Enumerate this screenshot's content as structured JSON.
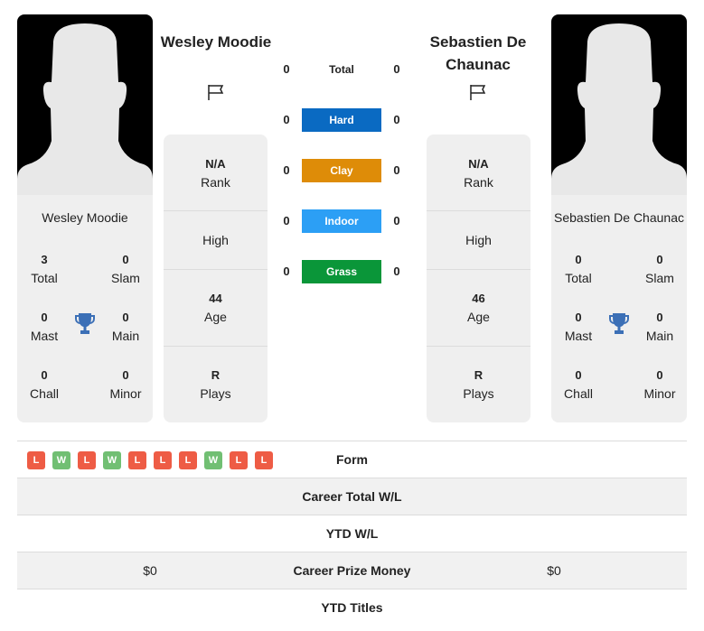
{
  "players": [
    {
      "name_heading": "Wesley Moodie",
      "card_name": "Wesley Moodie",
      "flag_icon": "flag-icon",
      "titles": {
        "total": {
          "value": "3",
          "label": "Total"
        },
        "slam": {
          "value": "0",
          "label": "Slam"
        },
        "mast": {
          "value": "0",
          "label": "Mast"
        },
        "main": {
          "value": "0",
          "label": "Main"
        },
        "chall": {
          "value": "0",
          "label": "Chall"
        },
        "minor": {
          "value": "0",
          "label": "Minor"
        }
      },
      "stats": {
        "rank": {
          "value": "N/A",
          "label": "Rank"
        },
        "high": {
          "label": "High"
        },
        "age": {
          "value": "44",
          "label": "Age"
        },
        "plays": {
          "value": "R",
          "label": "Plays"
        }
      }
    },
    {
      "name_heading": "Sebastien De Chaunac",
      "card_name": "Sebastien De Chaunac",
      "flag_icon": "flag-icon",
      "titles": {
        "total": {
          "value": "0",
          "label": "Total"
        },
        "slam": {
          "value": "0",
          "label": "Slam"
        },
        "mast": {
          "value": "0",
          "label": "Mast"
        },
        "main": {
          "value": "0",
          "label": "Main"
        },
        "chall": {
          "value": "0",
          "label": "Chall"
        },
        "minor": {
          "value": "0",
          "label": "Minor"
        }
      },
      "stats": {
        "rank": {
          "value": "N/A",
          "label": "Rank"
        },
        "high": {
          "label": "High"
        },
        "age": {
          "value": "46",
          "label": "Age"
        },
        "plays": {
          "value": "R",
          "label": "Plays"
        }
      }
    }
  ],
  "h2h": [
    {
      "surface": "Total",
      "left": "0",
      "right": "0",
      "color": ""
    },
    {
      "surface": "Hard",
      "left": "0",
      "right": "0",
      "color": "#0a6ac2"
    },
    {
      "surface": "Clay",
      "left": "0",
      "right": "0",
      "color": "#de8c08"
    },
    {
      "surface": "Indoor",
      "left": "0",
      "right": "0",
      "color": "#2c9ff5"
    },
    {
      "surface": "Grass",
      "left": "0",
      "right": "0",
      "color": "#0a9639"
    }
  ],
  "form": {
    "label": "Form",
    "results": [
      "L",
      "W",
      "L",
      "W",
      "L",
      "L",
      "L",
      "W",
      "L",
      "L"
    ],
    "colors": {
      "W": "#71bf73",
      "L": "#ee5c45"
    }
  },
  "table": [
    {
      "label": "Career Total W/L",
      "left": "",
      "right": ""
    },
    {
      "label": "YTD W/L",
      "left": "",
      "right": ""
    },
    {
      "label": "Career Prize Money",
      "left": "$0",
      "right": "$0"
    },
    {
      "label": "YTD Titles",
      "left": "",
      "right": ""
    }
  ]
}
